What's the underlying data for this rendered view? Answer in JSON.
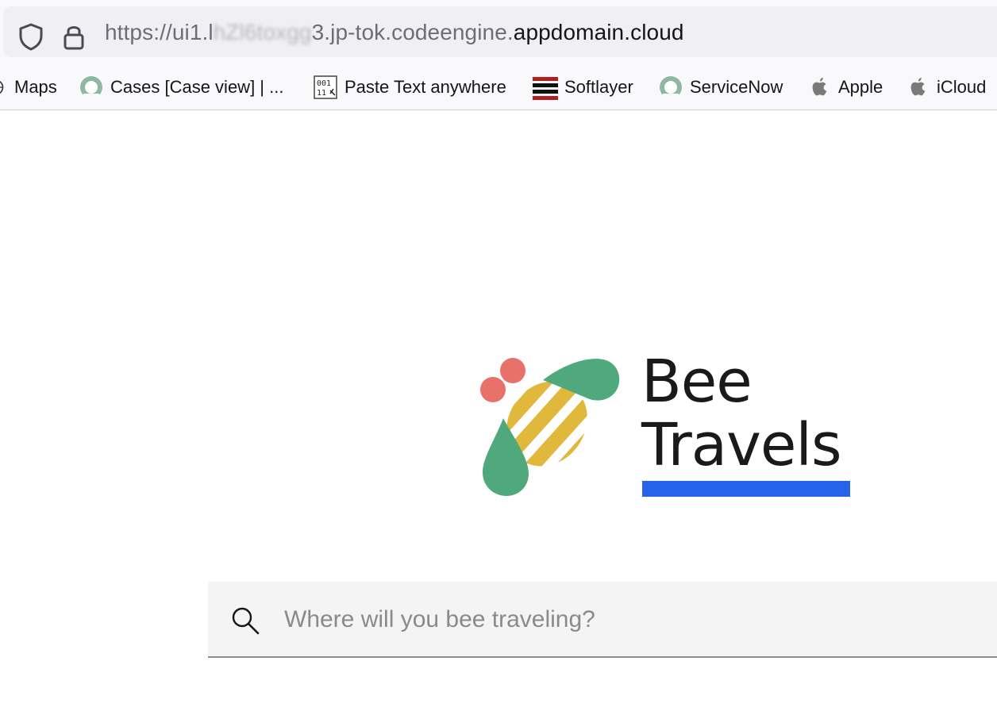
{
  "browser": {
    "url": {
      "prefix": "https://ui1.l",
      "blurred": "hZl6toxgg",
      "middle": "3.jp-tok.codeengine.",
      "domain": "appdomain.cloud"
    },
    "icons": {
      "shield": "shield-icon",
      "lock": "lock-icon"
    },
    "bookmarks": [
      {
        "label": "Maps",
        "icon": "globe-icon"
      },
      {
        "label": "Cases [Case view] | ...",
        "icon": "servicenow-icon"
      },
      {
        "label": "Paste Text anywhere",
        "icon": "binary-icon"
      },
      {
        "label": "Softlayer",
        "icon": "softlayer-icon"
      },
      {
        "label": "ServiceNow",
        "icon": "servicenow-icon"
      },
      {
        "label": "Apple",
        "icon": "apple-icon"
      },
      {
        "label": "iCloud",
        "icon": "apple-icon"
      }
    ]
  },
  "page": {
    "brand": {
      "line1": "Bee",
      "line2": "Travels"
    },
    "colors": {
      "accent": "#2563eb",
      "bee_green": "#4fa97c",
      "bee_yellow": "#e0b93c",
      "bee_red": "#e8716a"
    },
    "search": {
      "placeholder": "Where will you bee traveling?",
      "value": ""
    }
  }
}
